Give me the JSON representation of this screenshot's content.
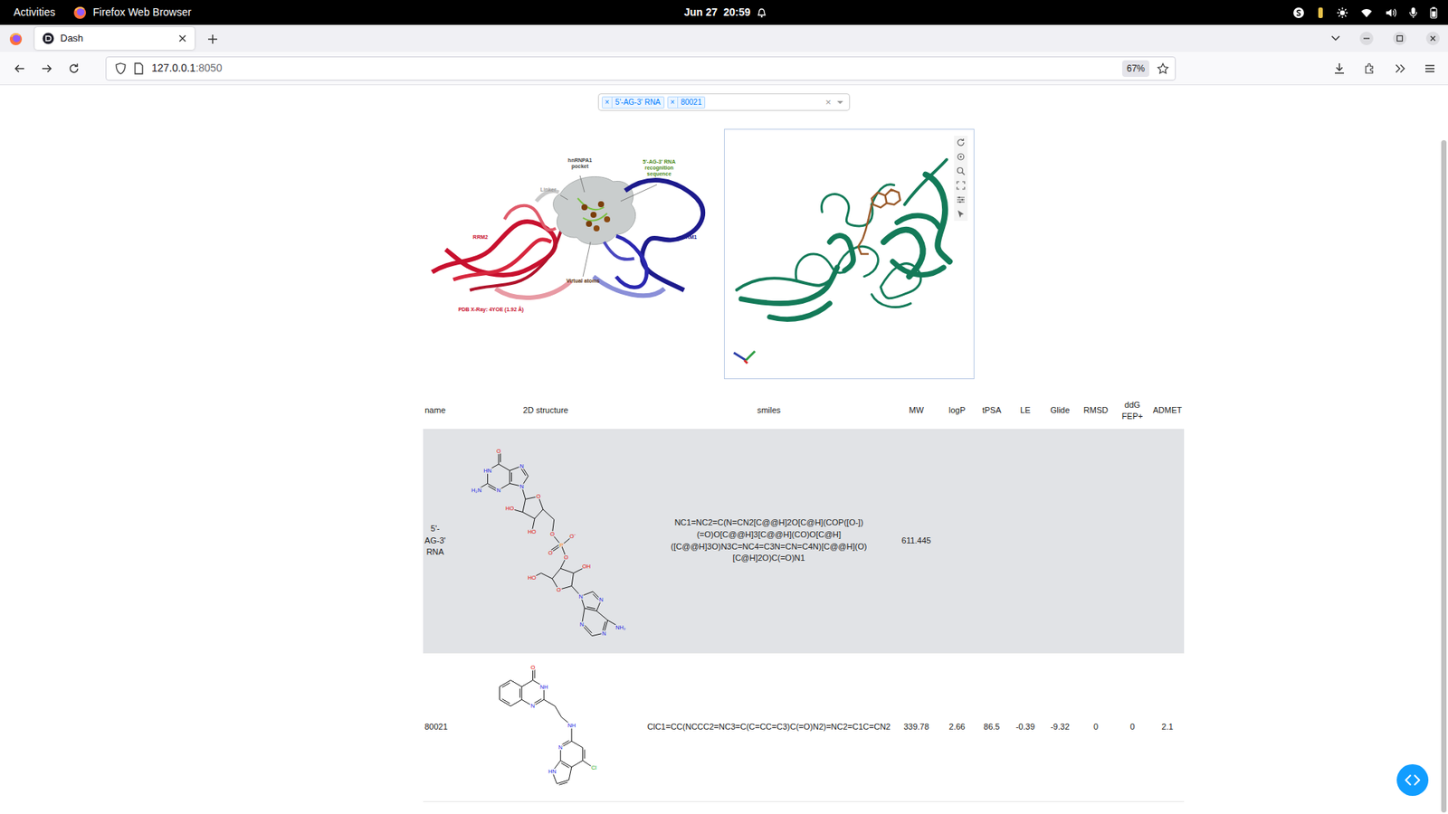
{
  "system_bar": {
    "activities": "Activities",
    "app_name": "Firefox Web Browser",
    "clock": "Jun 27  20:59"
  },
  "browser": {
    "tabs": [
      {
        "label": "Dash",
        "selected": true
      }
    ],
    "url": {
      "host": "127.0.0.1",
      "port": ":8050"
    },
    "zoom": "67%"
  },
  "compound_selector": {
    "tags": [
      {
        "label": "5'-AG-3' RNA",
        "remove": "×"
      },
      {
        "label": "80021",
        "remove": "×"
      }
    ],
    "clear": "×"
  },
  "figure": {
    "labels": {
      "pocket": "hnRNPA1 pocket",
      "recognition": "5'-AG-3' RNA recognition sequence",
      "linker": "Linker",
      "rrm2": "RRM2",
      "rrm1": "RRM1",
      "virtual_atoms": "Virtual atoms",
      "pdb": "PDB X-Ray: 4YOE (1.92 Å)"
    }
  },
  "table": {
    "columns": [
      "name",
      "2D structure",
      "smiles",
      "MW",
      "logP",
      "tPSA",
      "LE",
      "Glide",
      "RMSD",
      "ddG FEP+",
      "ADMET"
    ],
    "rows": [
      {
        "selected": true,
        "name": "5'-AG-3' RNA",
        "structure_labels": [
          "O",
          "HN",
          "H₂N",
          "N",
          "N",
          "N",
          "O",
          "HO",
          "HO",
          "O",
          "P",
          "O⁻",
          "O",
          "O",
          "O",
          "HO",
          "OH",
          "N",
          "N",
          "N",
          "N",
          "NH₂"
        ],
        "smiles": "NC1=NC2=C(N=CN2[C@@H]2O[C@H](COP([O-])(=O)O[C@@H]3[C@@H](CO)O[C@H]([C@@H]3O)N3C=NC4=C3N=CN=C4N)[C@@H](O)[C@H]2O)C(=O)N1",
        "values": [
          "611.445",
          "",
          "",
          "",
          "",
          "",
          "",
          ""
        ]
      },
      {
        "selected": false,
        "name": "80021",
        "structure_labels": [
          "O",
          "NH",
          "N",
          "NH",
          "N",
          "Cl",
          "HN"
        ],
        "smiles": "ClC1=CC(NCCC2=NC3=C(C=CC=C3)C(=O)N2)=NC2=C1C=CN2",
        "values": [
          "339.78",
          "2.66",
          "86.5",
          "-0.39",
          "-9.32",
          "0",
          "0",
          "2.1"
        ]
      }
    ]
  }
}
